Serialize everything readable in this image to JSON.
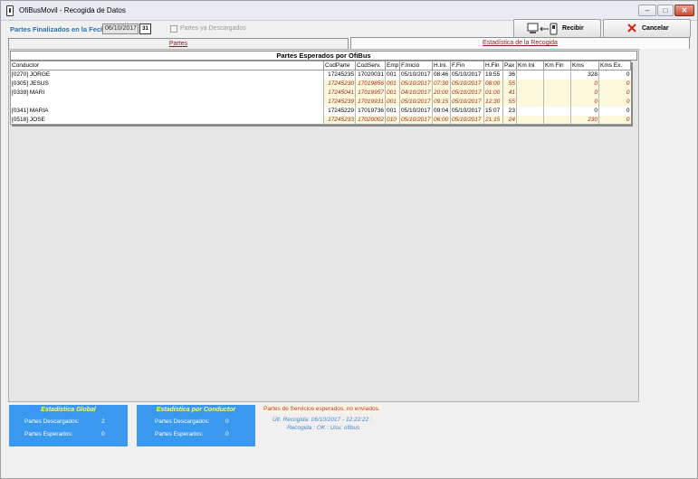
{
  "window": {
    "title": "OfiBusMovil - Recogida de Datos"
  },
  "toolbar": {
    "fecha_label": "Partes Finalizados en la Fecha",
    "fecha_value": "06/10/2017",
    "calendar_icon": "calendar-icon",
    "descargados_label": "Partes ya Descargados",
    "descargados_checked": false,
    "recibir_label": "Recibir",
    "cancelar_label": "Cancelar"
  },
  "tabs": [
    {
      "label": "Partes",
      "active": false
    },
    {
      "label": "Estadística de la Recogida",
      "active": true
    }
  ],
  "grid": {
    "title": "Partes Esperados por OfiBus",
    "columns": [
      "Conductor",
      "CodParte",
      "CodServ.",
      "Emp",
      "F.Inicio",
      "H.Ini.",
      "F.Fin",
      "H.Fin",
      "Pax",
      "Km Ini",
      "Km Fin",
      "Kms",
      "Kms Ex."
    ],
    "rows": [
      {
        "pending": false,
        "cells": [
          "[0270] JORGE",
          "17245235",
          "17020031",
          "001",
          "05/10/2017",
          "08:46",
          "05/10/2017",
          "19:55",
          "36",
          "",
          "",
          "328",
          "0"
        ]
      },
      {
        "pending": true,
        "cells": [
          "[0305] JESUS",
          "17245230",
          "17019856",
          "001",
          "05/10/2017",
          "07:30",
          "05/10/2017",
          "08:00",
          "55",
          "",
          "",
          "0",
          "0"
        ]
      },
      {
        "pending": true,
        "cells": [
          "[0339] MARI",
          "17245041",
          "17019957",
          "001",
          "04/10/2017",
          "20:00",
          "05/10/2017",
          "01:00",
          "41",
          "",
          "",
          "0",
          "0"
        ]
      },
      {
        "pending": true,
        "cells": [
          "",
          "17245239",
          "17019931",
          "001",
          "05/10/2017",
          "09:15",
          "05/10/2017",
          "12:30",
          "55",
          "",
          "",
          "0",
          "0"
        ]
      },
      {
        "pending": false,
        "cells": [
          "[0341] MARIA",
          "17245229",
          "17019736",
          "001",
          "05/10/2017",
          "09:04",
          "05/10/2017",
          "15:07",
          "23",
          "",
          "",
          "0",
          "0"
        ]
      },
      {
        "pending": true,
        "cells": [
          "[0518] JOSE",
          "17245233",
          "17020002",
          "010",
          "05/10/2017",
          "06:00",
          "05/10/2017",
          "21:15",
          "24",
          "",
          "",
          "230",
          "0"
        ]
      }
    ]
  },
  "stats_global": {
    "title": "Estadística Global",
    "descargados_label": "Partes Descargados:",
    "descargados_value": "2",
    "esperados_label": "Partes Esperados:",
    "esperados_value": "0"
  },
  "stats_conductor": {
    "title": "Estadística por Conductor",
    "descargados_label": "Partes Descargados:",
    "descargados_value": "0",
    "esperados_label": "Partes Esperados:",
    "esperados_value": "0"
  },
  "status": {
    "pending_message": "Partes de Servicios esperados, no enviados.",
    "ultima_recogida": "Últ. Recogida: 06/10/2017 - 12:22:22 :",
    "recogida_ok": "Recogida : OK : Usu: ofibus"
  },
  "colors": {
    "accent": "#3a98ee",
    "stat_title": "#ffff66",
    "pending_text": "#a52a1a",
    "pending_bg": "#fcf8dc",
    "label_blue": "#2b6fb5"
  }
}
